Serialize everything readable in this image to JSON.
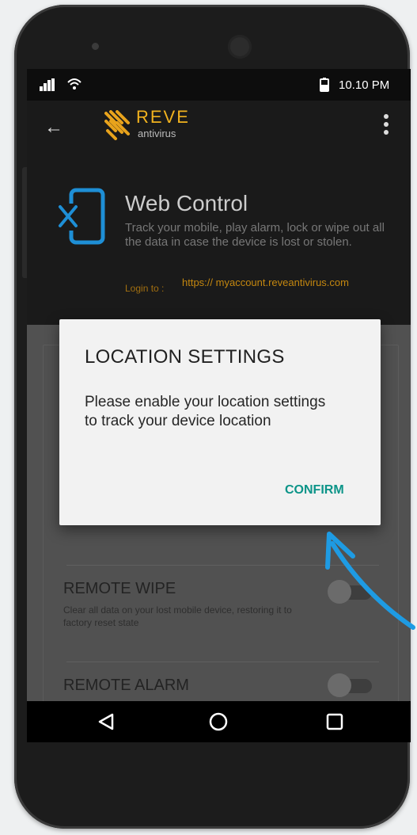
{
  "status_bar": {
    "time": "10.10 PM"
  },
  "app_bar": {
    "brand_name": "REVE",
    "brand_sub": "antivirus"
  },
  "hero": {
    "title": "Web Control",
    "description": "Track your mobile, play alarm, lock or wipe out all the data in case the device is lost or stolen.",
    "login_label": "Login to :",
    "login_link": "https:// myaccount.reveantivirus.com"
  },
  "features": [
    {
      "title": "REMOTE WIPE",
      "description": "Clear all data on your lost mobile device, restoring it to factory reset state"
    },
    {
      "title": "REMOTE ALARM"
    }
  ],
  "dialog": {
    "title": "LOCATION SETTINGS",
    "message": "Please enable your location settings to track your device location",
    "confirm_label": "CONFIRM"
  },
  "colors": {
    "brand": "#f1b21e",
    "accent": "#0b9488",
    "annotation_arrow": "#1e9be3"
  }
}
